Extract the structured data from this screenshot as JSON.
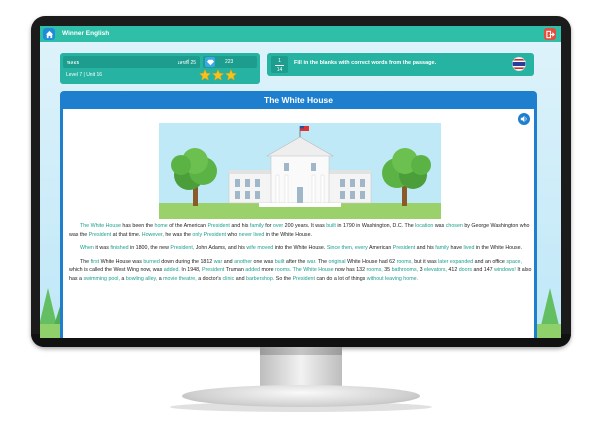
{
  "app": {
    "title": "Winner English"
  },
  "user": {
    "name": "พลอย",
    "id_label": "เลขที่ 25",
    "gems": "223",
    "level": "Level 7 | Unit 16",
    "stars": 3
  },
  "exercise": {
    "progress_current": "1",
    "progress_total": "14",
    "instruction": "Fill in the blanks with correct words from the passage."
  },
  "article": {
    "title": "The White House",
    "paragraphs": [
      [
        {
          "t": "The White House",
          "h": true
        },
        {
          "t": " has been the "
        },
        {
          "t": "home",
          "h": true
        },
        {
          "t": " of the American "
        },
        {
          "t": "President",
          "h": true
        },
        {
          "t": " and his "
        },
        {
          "t": "family",
          "h": true
        },
        {
          "t": " for "
        },
        {
          "t": "over",
          "h": true
        },
        {
          "t": " 200 years. It was "
        },
        {
          "t": "built",
          "h": true
        },
        {
          "t": " in 1790 in Washington, D.C. The "
        },
        {
          "t": "location",
          "h": true
        },
        {
          "t": " was "
        },
        {
          "t": "chosen",
          "h": true
        },
        {
          "t": " by George Washington who was the "
        },
        {
          "t": "President",
          "h": true
        },
        {
          "t": " at that time. "
        },
        {
          "t": "However,",
          "h": true
        },
        {
          "t": " he was the "
        },
        {
          "t": "only",
          "h": true
        },
        {
          "t": " "
        },
        {
          "t": "President",
          "h": true
        },
        {
          "t": " who "
        },
        {
          "t": "never lived",
          "h": true
        },
        {
          "t": " in the White House."
        }
      ],
      [
        {
          "t": "When",
          "h": true
        },
        {
          "t": " it was "
        },
        {
          "t": "finished",
          "h": true
        },
        {
          "t": " in 1800, the new "
        },
        {
          "t": "President,",
          "h": true
        },
        {
          "t": " John Adams, and his "
        },
        {
          "t": "wife",
          "h": true
        },
        {
          "t": " "
        },
        {
          "t": "moved",
          "h": true
        },
        {
          "t": " into the White House. "
        },
        {
          "t": "Since then,",
          "h": true
        },
        {
          "t": " "
        },
        {
          "t": "every",
          "h": true
        },
        {
          "t": " American "
        },
        {
          "t": "President",
          "h": true
        },
        {
          "t": " and his "
        },
        {
          "t": "family",
          "h": true
        },
        {
          "t": " have "
        },
        {
          "t": "lived",
          "h": true
        },
        {
          "t": " in the White House."
        }
      ],
      [
        {
          "t": "The "
        },
        {
          "t": "first",
          "h": true
        },
        {
          "t": " White House was "
        },
        {
          "t": "burned",
          "h": true
        },
        {
          "t": " down during the 1812 "
        },
        {
          "t": "war",
          "h": true
        },
        {
          "t": " and "
        },
        {
          "t": "another",
          "h": true
        },
        {
          "t": " one was "
        },
        {
          "t": "built",
          "h": true
        },
        {
          "t": " after the "
        },
        {
          "t": "war.",
          "h": true
        },
        {
          "t": " The "
        },
        {
          "t": "original",
          "h": true
        },
        {
          "t": " White House had 62 "
        },
        {
          "t": "rooms,",
          "h": true
        },
        {
          "t": " but it was "
        },
        {
          "t": "later",
          "h": true
        },
        {
          "t": " "
        },
        {
          "t": "expanded",
          "h": true
        },
        {
          "t": " and an office "
        },
        {
          "t": "space,",
          "h": true
        },
        {
          "t": " which is called the West Wing now, was "
        },
        {
          "t": "added.",
          "h": true
        },
        {
          "t": " In 1948, "
        },
        {
          "t": "President",
          "h": true
        },
        {
          "t": " Truman "
        },
        {
          "t": "added",
          "h": true
        },
        {
          "t": " more "
        },
        {
          "t": "rooms.",
          "h": true
        },
        {
          "t": " The White House",
          "h": true
        },
        {
          "t": " now has 132 "
        },
        {
          "t": "rooms,",
          "h": true
        },
        {
          "t": " 35 "
        },
        {
          "t": "bathrooms,",
          "h": true
        },
        {
          "t": " 3 "
        },
        {
          "t": "elevators,",
          "h": true
        },
        {
          "t": " 412 "
        },
        {
          "t": "doors",
          "h": true
        },
        {
          "t": " and 147 "
        },
        {
          "t": "windows!",
          "h": true
        },
        {
          "t": " It also has a "
        },
        {
          "t": "swimming pool,",
          "h": true
        },
        {
          "t": " a "
        },
        {
          "t": "bowling alley,",
          "h": true
        },
        {
          "t": " a "
        },
        {
          "t": "movie theatre,",
          "h": true
        },
        {
          "t": " a doctor's "
        },
        {
          "t": "clinic",
          "h": true
        },
        {
          "t": " and "
        },
        {
          "t": "barbershop.",
          "h": true
        },
        {
          "t": " So the "
        },
        {
          "t": "President",
          "h": true
        },
        {
          "t": " can do a lot of things "
        },
        {
          "t": "without leaving home.",
          "h": true
        }
      ]
    ]
  },
  "colors": {
    "topbar": "#2fbfa9",
    "panel": "#27b3a2",
    "article_header": "#1e7fcf",
    "highlight": "#1a9e8c"
  },
  "icons": [
    "home-icon",
    "exit-icon",
    "gem-icon",
    "star-icon",
    "speaker-icon",
    "flag-icon"
  ]
}
